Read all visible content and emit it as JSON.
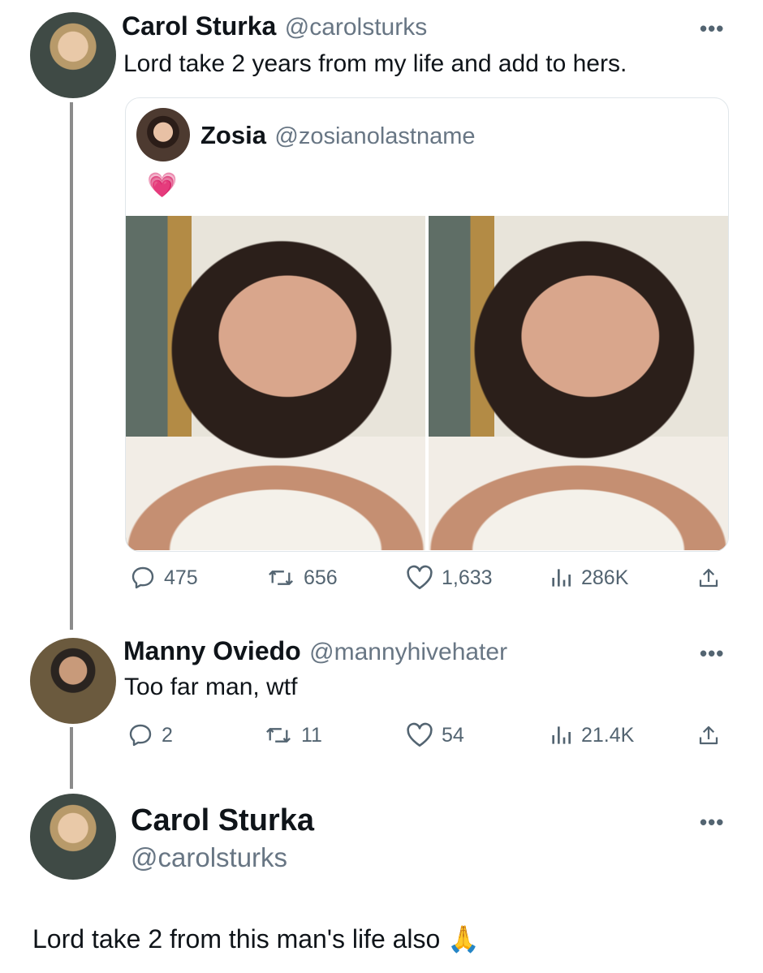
{
  "tweet1": {
    "name": "Carol Sturka",
    "handle": "@carolsturks",
    "text": "Lord take 2 years from my life and add to hers.",
    "more": "•••",
    "quote": {
      "name": "Zosia",
      "handle": "@zosianolastname",
      "text": "💗"
    },
    "stats": {
      "replies": "475",
      "retweets": "656",
      "likes": "1,633",
      "views": "286K"
    }
  },
  "tweet2": {
    "name": "Manny Oviedo",
    "handle": "@mannyhivehater",
    "text": "Too far man, wtf",
    "more": "•••",
    "stats": {
      "replies": "2",
      "retweets": "11",
      "likes": "54",
      "views": "21.4K"
    }
  },
  "tweet3": {
    "name": "Carol Sturka",
    "handle": "@carolsturks",
    "text": "Lord take 2 from this man's life also 🙏",
    "more": "•••"
  },
  "icons": {
    "reply": "reply-icon",
    "retweet": "retweet-icon",
    "like": "heart-icon",
    "views": "views-icon",
    "share": "share-icon",
    "more": "more-icon"
  },
  "colors": {
    "text": "#0f1419",
    "secondary": "#536471",
    "thread_line": "#8b8b8b"
  }
}
